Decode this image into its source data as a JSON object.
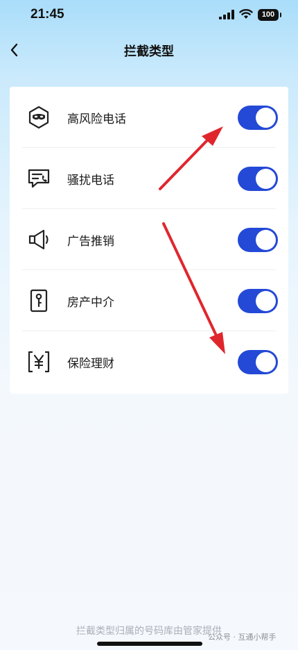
{
  "status_bar": {
    "time": "21:45",
    "battery": "100"
  },
  "nav": {
    "title": "拦截类型"
  },
  "items": [
    {
      "label": "高风险电话",
      "icon": "masked-face-icon",
      "enabled": true
    },
    {
      "label": "骚扰电话",
      "icon": "chat-phone-icon",
      "enabled": true
    },
    {
      "label": "广告推销",
      "icon": "megaphone-icon",
      "enabled": true
    },
    {
      "label": "房产中介",
      "icon": "key-door-icon",
      "enabled": true
    },
    {
      "label": "保险理财",
      "icon": "yen-icon",
      "enabled": true
    }
  ],
  "footer": {
    "note": "拦截类型归属的号码库由管家提供"
  },
  "watermark": {
    "text": "公众号 · 互通小帮手"
  },
  "colors": {
    "accent": "#2449d6",
    "annotation_arrow": "#e0262d"
  }
}
